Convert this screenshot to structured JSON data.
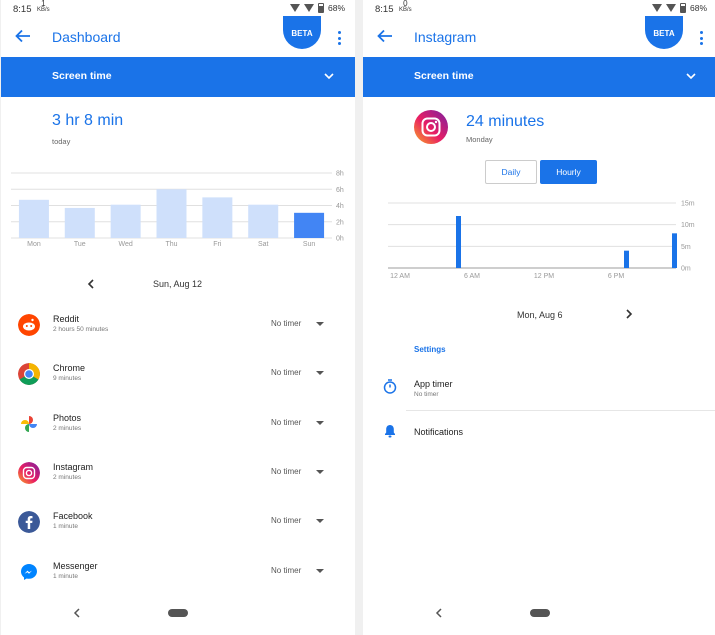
{
  "colors": {
    "accent": "#1a73e8",
    "bar_light": "#cfe0fb",
    "bar_selected": "#4285f4"
  },
  "status": {
    "left": {
      "time": "8:15",
      "net_value": "1",
      "net_unit": "KB/s",
      "battery": "68%"
    },
    "right": {
      "time": "8:15",
      "net_value": "0",
      "net_unit": "KB/s",
      "battery": "68%"
    }
  },
  "dashboard": {
    "title": "Dashboard",
    "beta": "BETA",
    "section": "Screen time",
    "total": "3 hr 8 min",
    "total_sub": "today",
    "date": "Sun, Aug 12",
    "apps": [
      {
        "name": "Reddit",
        "duration": "2 hours 50 minutes",
        "timer": "No timer",
        "icon": "reddit-icon"
      },
      {
        "name": "Chrome",
        "duration": "9 minutes",
        "timer": "No timer",
        "icon": "chrome-icon"
      },
      {
        "name": "Photos",
        "duration": "2 minutes",
        "timer": "No timer",
        "icon": "photos-icon"
      },
      {
        "name": "Instagram",
        "duration": "2 minutes",
        "timer": "No timer",
        "icon": "instagram-icon"
      },
      {
        "name": "Facebook",
        "duration": "1 minute",
        "timer": "No timer",
        "icon": "facebook-icon"
      },
      {
        "name": "Messenger",
        "duration": "1 minute",
        "timer": "No timer",
        "icon": "messenger-icon"
      }
    ]
  },
  "instagram": {
    "title": "Instagram",
    "beta": "BETA",
    "section": "Screen time",
    "total": "24 minutes",
    "total_sub": "Monday",
    "toggle_daily": "Daily",
    "toggle_hourly": "Hourly",
    "date": "Mon, Aug 6",
    "settings_header": "Settings",
    "app_timer": "App timer",
    "app_timer_sub": "No timer",
    "notifications": "Notifications"
  },
  "chart_data": [
    {
      "type": "bar",
      "categories": [
        "Mon",
        "Tue",
        "Wed",
        "Thu",
        "Fri",
        "Sat",
        "Sun"
      ],
      "values": [
        4.7,
        3.7,
        4.1,
        6.0,
        5.0,
        4.1,
        3.1
      ],
      "selected_index": 6,
      "y_ticks": [
        "0h",
        "2h",
        "4h",
        "6h",
        "8h"
      ],
      "ylim": [
        0,
        8
      ],
      "grid": true
    },
    {
      "type": "bar",
      "x_ticks": [
        "12 AM",
        "6 AM",
        "12 PM",
        "6 PM"
      ],
      "hours": [
        6,
        20,
        24
      ],
      "values": [
        12,
        4,
        8
      ],
      "y_ticks": [
        "0m",
        "5m",
        "10m",
        "15m"
      ],
      "ylim": [
        0,
        15
      ],
      "grid": true
    }
  ]
}
